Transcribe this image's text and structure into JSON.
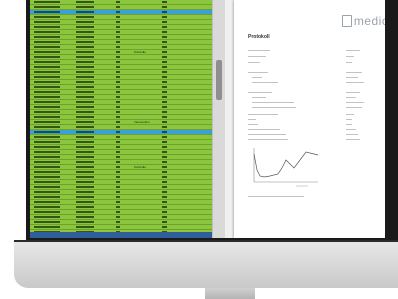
{
  "document": {
    "logo_text": "medicus",
    "title": "Protokoll"
  },
  "spreadsheet": {
    "row_count": 52,
    "highlight_rows": [
      3,
      27,
      52
    ],
    "tagged_rows": [
      {
        "row": 11,
        "label": "Kontrolle"
      },
      {
        "row": 25,
        "label": "Intervention"
      },
      {
        "row": 34,
        "label": "Kontrolle"
      },
      {
        "row": 51,
        "label": "Intervention"
      }
    ]
  },
  "colors": {
    "sheet_green": "#8cc63e",
    "row_highlight": "#3aa0d8"
  }
}
